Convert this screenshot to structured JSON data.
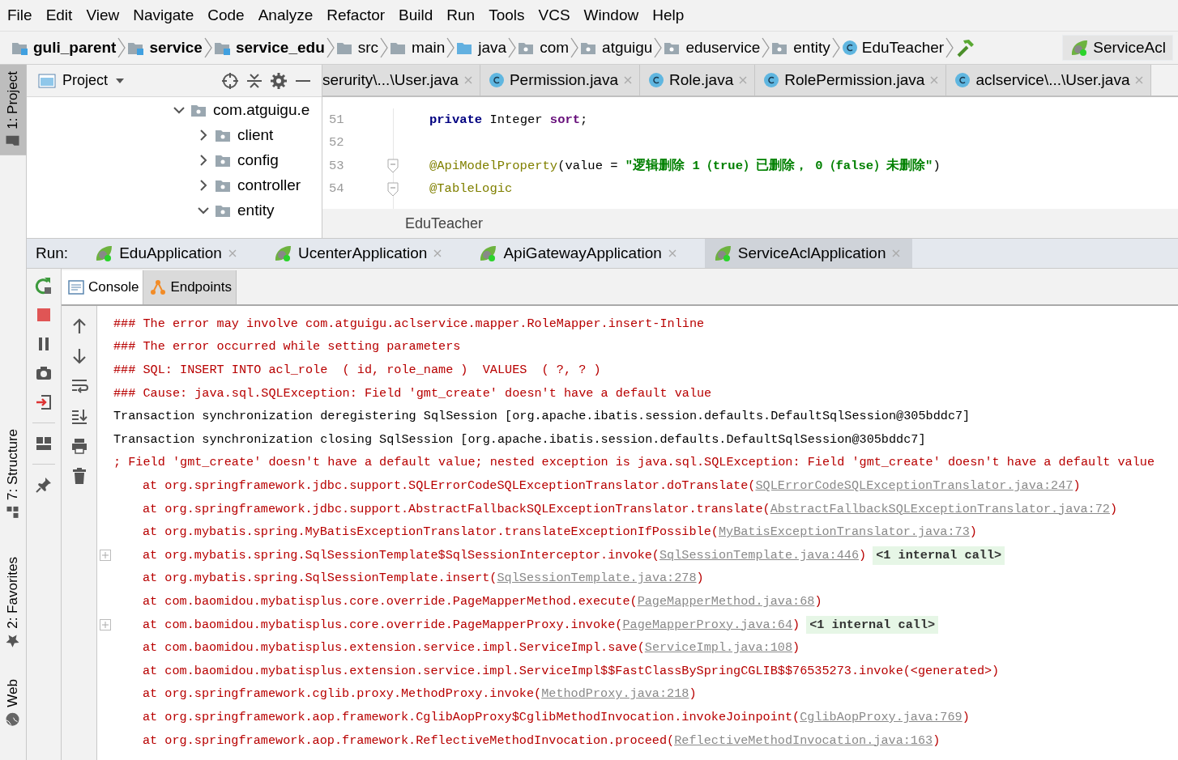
{
  "menu": [
    "File",
    "Edit",
    "View",
    "Navigate",
    "Code",
    "Analyze",
    "Refactor",
    "Build",
    "Run",
    "Tools",
    "VCS",
    "Window",
    "Help"
  ],
  "breadcrumbs": [
    {
      "label": "guli_parent",
      "kind": "module"
    },
    {
      "label": "service",
      "kind": "module"
    },
    {
      "label": "service_edu",
      "kind": "module"
    },
    {
      "label": "src",
      "kind": "folder"
    },
    {
      "label": "main",
      "kind": "folder"
    },
    {
      "label": "java",
      "kind": "source"
    },
    {
      "label": "com",
      "kind": "package"
    },
    {
      "label": "atguigu",
      "kind": "package"
    },
    {
      "label": "eduservice",
      "kind": "package"
    },
    {
      "label": "entity",
      "kind": "package"
    },
    {
      "label": "EduTeacher",
      "kind": "class"
    }
  ],
  "run_config": {
    "label": "ServiceAcl"
  },
  "tool_stripe": [
    {
      "label": "1: Project",
      "selected": true,
      "kind": "project"
    },
    {
      "label": "7: Structure",
      "selected": false,
      "kind": "structure"
    },
    {
      "label": "2: Favorites",
      "selected": false,
      "kind": "favorites"
    },
    {
      "label": "Web",
      "selected": false,
      "kind": "web"
    }
  ],
  "project_panel": {
    "title": "Project",
    "tree": [
      {
        "label": "com.atguigu.e",
        "expanded": true,
        "children": [
          {
            "label": "client",
            "expanded": false
          },
          {
            "label": "config",
            "expanded": false
          },
          {
            "label": "controller",
            "expanded": false
          },
          {
            "label": "entity",
            "expanded": true
          }
        ]
      }
    ]
  },
  "editor_tabs": [
    {
      "label": "serurity\\...\\User.java",
      "icon": false,
      "selected": false
    },
    {
      "label": "Permission.java",
      "icon": true,
      "selected": false
    },
    {
      "label": "Role.java",
      "icon": true,
      "selected": false
    },
    {
      "label": "RolePermission.java",
      "icon": true,
      "selected": false
    },
    {
      "label": "aclservice\\...\\User.java",
      "icon": true,
      "selected": false
    }
  ],
  "code_lines": [
    {
      "number": "51",
      "fold": false,
      "tokens": [
        {
          "kind": "keyword",
          "text": "private"
        },
        {
          "kind": "plain",
          "text": " Integer "
        },
        {
          "kind": "field",
          "text": "sort"
        },
        {
          "kind": "plain",
          "text": ";"
        }
      ]
    },
    {
      "number": "52",
      "fold": false
    },
    {
      "number": "53",
      "fold": true,
      "tokens": [
        {
          "kind": "annotation",
          "text": "@ApiModelProperty"
        },
        {
          "kind": "plain",
          "text": "(value = "
        },
        {
          "kind": "string",
          "text": "\"逻辑删除 1（true）已删除， 0（false）未删除\""
        },
        {
          "kind": "plain",
          "text": ")"
        }
      ]
    },
    {
      "number": "54",
      "fold": true,
      "tokens": [
        {
          "kind": "annotation",
          "text": "@TableLogic"
        }
      ]
    }
  ],
  "editor_breadcrumb": "EduTeacher",
  "run_panel": {
    "label": "Run:",
    "tabs": [
      {
        "label": "EduApplication",
        "selected": false
      },
      {
        "label": "UcenterApplication",
        "selected": false
      },
      {
        "label": "ApiGatewayApplication",
        "selected": false
      },
      {
        "label": "ServiceAclApplication",
        "selected": true
      }
    ],
    "console_tabs": [
      {
        "label": "Console",
        "kind": "console",
        "selected": true
      },
      {
        "label": "Endpoints",
        "kind": "endpoints",
        "selected": false
      }
    ],
    "lines": [
      {
        "kind": "error",
        "segments": [
          {
            "kind": "plain",
            "text": "### The error may involve com.atguigu.aclservice.mapper.RoleMapper.insert-Inline"
          }
        ]
      },
      {
        "kind": "error",
        "segments": [
          {
            "kind": "plain",
            "text": "### The error occurred while setting parameters"
          }
        ]
      },
      {
        "kind": "error",
        "segments": [
          {
            "kind": "plain",
            "text": "### SQL: INSERT INTO acl_role  ( id, role_name )  VALUES  ( ?, ? )"
          }
        ]
      },
      {
        "kind": "error",
        "segments": [
          {
            "kind": "plain",
            "text": "### Cause: java.sql.SQLException: Field 'gmt_create' doesn't have a default value"
          }
        ]
      },
      {
        "kind": "info",
        "segments": [
          {
            "kind": "plain",
            "text": "Transaction synchronization deregistering SqlSession [org.apache.ibatis.session.defaults.DefaultSqlSession@305bddc7]"
          }
        ]
      },
      {
        "kind": "info",
        "segments": [
          {
            "kind": "plain",
            "text": "Transaction synchronization closing SqlSession [org.apache.ibatis.session.defaults.DefaultSqlSession@305bddc7]"
          }
        ]
      },
      {
        "kind": "error",
        "segments": [
          {
            "kind": "plain",
            "text": "; Field 'gmt_create' doesn't have a default value; nested exception is java.sql.SQLException: Field 'gmt_create' doesn't have a default value"
          }
        ]
      },
      {
        "kind": "trace",
        "segments": [
          {
            "kind": "plain",
            "text": "at org.springframework.jdbc.support.SQLErrorCodeSQLExceptionTranslator.doTranslate("
          },
          {
            "kind": "link",
            "text": "SQLErrorCodeSQLExceptionTranslator.java:247"
          },
          {
            "kind": "plain",
            "text": ")"
          }
        ]
      },
      {
        "kind": "trace",
        "segments": [
          {
            "kind": "plain",
            "text": "at org.springframework.jdbc.support.AbstractFallbackSQLExceptionTranslator.translate("
          },
          {
            "kind": "link",
            "text": "AbstractFallbackSQLExceptionTranslator.java:72"
          },
          {
            "kind": "plain",
            "text": ")"
          }
        ]
      },
      {
        "kind": "trace",
        "segments": [
          {
            "kind": "plain",
            "text": "at org.mybatis.spring.MyBatisExceptionTranslator.translateExceptionIfPossible("
          },
          {
            "kind": "link",
            "text": "MyBatisExceptionTranslator.java:73"
          },
          {
            "kind": "plain",
            "text": ")"
          }
        ]
      },
      {
        "kind": "trace",
        "segments": [
          {
            "kind": "plain",
            "text": "at org.mybatis.spring.SqlSessionTemplate$SqlSessionInterceptor.invoke("
          },
          {
            "kind": "link",
            "text": "SqlSessionTemplate.java:446"
          },
          {
            "kind": "plain",
            "text": ")"
          },
          {
            "kind": "folded",
            "text": "<1 internal call>"
          }
        ]
      },
      {
        "kind": "trace",
        "segments": [
          {
            "kind": "plain",
            "text": "at org.mybatis.spring.SqlSessionTemplate.insert("
          },
          {
            "kind": "link",
            "text": "SqlSessionTemplate.java:278"
          },
          {
            "kind": "plain",
            "text": ")"
          }
        ]
      },
      {
        "kind": "trace",
        "segments": [
          {
            "kind": "plain",
            "text": "at com.baomidou.mybatisplus.core.override.PageMapperMethod.execute("
          },
          {
            "kind": "link",
            "text": "PageMapperMethod.java:68"
          },
          {
            "kind": "plain",
            "text": ")"
          }
        ]
      },
      {
        "kind": "trace",
        "segments": [
          {
            "kind": "plain",
            "text": "at com.baomidou.mybatisplus.core.override.PageMapperProxy.invoke("
          },
          {
            "kind": "link",
            "text": "PageMapperProxy.java:64"
          },
          {
            "kind": "plain",
            "text": ")"
          },
          {
            "kind": "folded",
            "text": "<1 internal call>"
          }
        ]
      },
      {
        "kind": "trace",
        "segments": [
          {
            "kind": "plain",
            "text": "at com.baomidou.mybatisplus.extension.service.impl.ServiceImpl.save("
          },
          {
            "kind": "link",
            "text": "ServiceImpl.java:108"
          },
          {
            "kind": "plain",
            "text": ")"
          }
        ]
      },
      {
        "kind": "trace",
        "segments": [
          {
            "kind": "plain",
            "text": "at com.baomidou.mybatisplus.extension.service.impl.ServiceImpl$$FastClassBySpringCGLIB$$76535273.invoke(<generated>)"
          }
        ]
      },
      {
        "kind": "trace",
        "segments": [
          {
            "kind": "plain",
            "text": "at org.springframework.cglib.proxy.MethodProxy.invoke("
          },
          {
            "kind": "link",
            "text": "MethodProxy.java:218"
          },
          {
            "kind": "plain",
            "text": ")"
          }
        ]
      },
      {
        "kind": "trace",
        "segments": [
          {
            "kind": "plain",
            "text": "at org.springframework.aop.framework.CglibAopProxy$CglibMethodInvocation.invokeJoinpoint("
          },
          {
            "kind": "link",
            "text": "CglibAopProxy.java:769"
          },
          {
            "kind": "plain",
            "text": ")"
          }
        ]
      },
      {
        "kind": "trace",
        "segments": [
          {
            "kind": "plain",
            "text": "at org.springframework.aop.framework.ReflectiveMethodInvocation.proceed("
          },
          {
            "kind": "link",
            "text": "ReflectiveMethodInvocation.java:163"
          },
          {
            "kind": "plain",
            "text": ")"
          }
        ]
      }
    ]
  }
}
